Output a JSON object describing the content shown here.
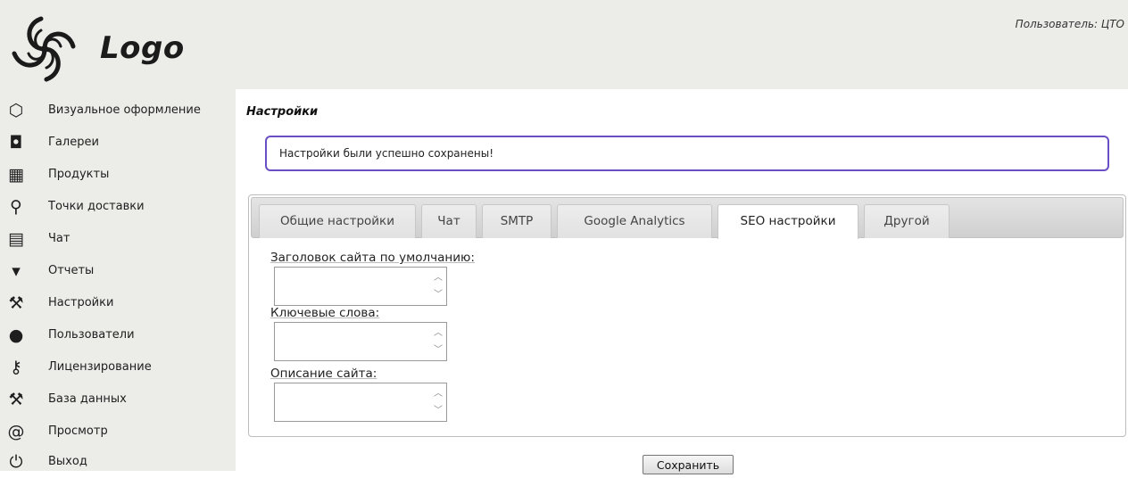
{
  "header": {
    "logo_text": "Logo",
    "user_label": "Пользователь: ЦТО"
  },
  "sidebar": {
    "items": [
      {
        "icon": "paint-bucket-icon",
        "glyph": "⬡",
        "label": "Визуальное оформление"
      },
      {
        "icon": "camera-icon",
        "glyph": "◘",
        "label": "Галереи"
      },
      {
        "icon": "gift-icon",
        "glyph": "▦",
        "label": "Продукты"
      },
      {
        "icon": "delivery-points-icon",
        "glyph": "⚲",
        "label": "Точки доставки"
      },
      {
        "icon": "chat-icon",
        "glyph": "▤",
        "label": "Чат"
      },
      {
        "icon": "report-bubble-icon",
        "glyph": "▾",
        "label": "Отчеты"
      },
      {
        "icon": "wrench-icon",
        "glyph": "⚒",
        "label": "Настройки"
      },
      {
        "icon": "user-icon",
        "glyph": "●",
        "label": "Пользователи"
      },
      {
        "icon": "key-icon",
        "glyph": "⚷",
        "label": "Лицензирование"
      },
      {
        "icon": "wrench-icon",
        "glyph": "⚒",
        "label": "База данных"
      },
      {
        "icon": "at-icon",
        "glyph": "@",
        "label": "Просмотр"
      },
      {
        "icon": "power-icon",
        "glyph": "⏻",
        "label": "Выход"
      }
    ]
  },
  "main": {
    "page_title": "Настройки",
    "alert": "Настройки были успешно сохранены!",
    "tabs": [
      {
        "label": "Общие настройки",
        "active": false
      },
      {
        "label": "Чат",
        "active": false
      },
      {
        "label": "SMTP",
        "active": false
      },
      {
        "label": "Google Analytics",
        "active": false
      },
      {
        "label": "SEO настройки",
        "active": true
      },
      {
        "label": "Другой",
        "active": false
      }
    ],
    "fields": [
      {
        "label": "Заголовок сайта по умолчанию:",
        "value": ""
      },
      {
        "label": "Ключевые слова:",
        "value": ""
      },
      {
        "label": "Описание сайта:",
        "value": ""
      }
    ],
    "save_label": "Сохранить"
  }
}
